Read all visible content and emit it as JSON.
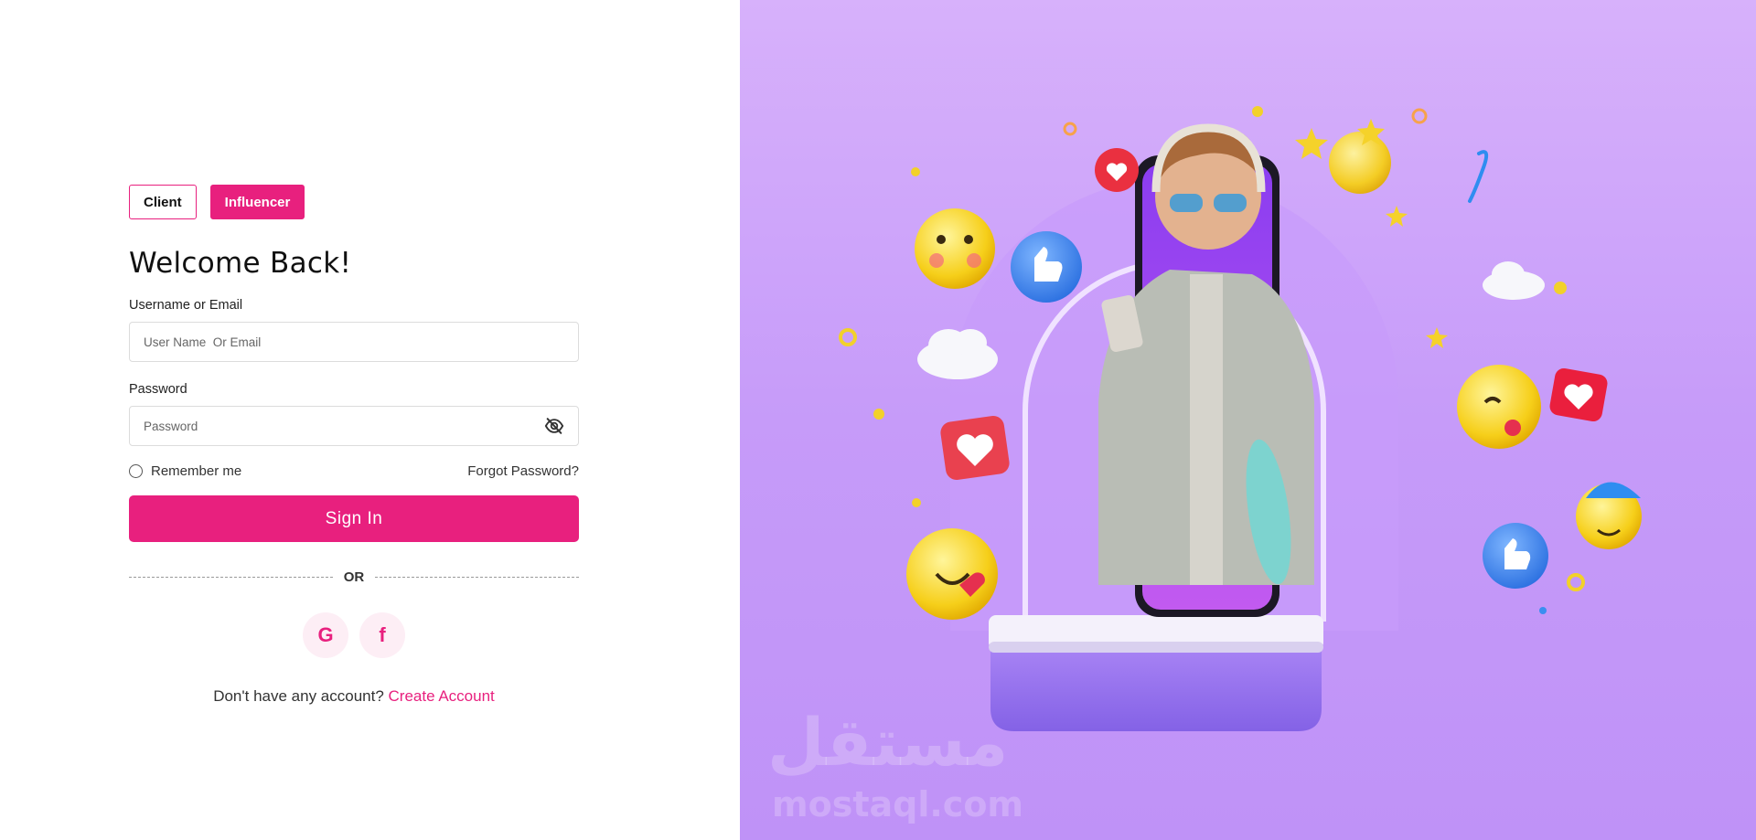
{
  "roles": {
    "client": "Client",
    "influencer": "Influencer"
  },
  "heading": "Welcome Back!",
  "username": {
    "label": "Username or Email",
    "placeholder": "User Name  Or Email"
  },
  "password": {
    "label": "Password",
    "placeholder": "Password"
  },
  "remember_label": "Remember me",
  "forgot_label": "Forgot Password?",
  "signin_label": "Sign In",
  "or_label": "OR",
  "social": {
    "google": "G",
    "facebook": "f"
  },
  "account": {
    "prompt": "Don't have any account?",
    "link": "Create Account"
  },
  "watermark": {
    "arabic": "مستقل",
    "latin": "mostaql.com"
  },
  "colors": {
    "accent": "#e8207e",
    "panel": "#c69bf9"
  },
  "icons": [
    "eye-off-icon",
    "google-icon",
    "facebook-icon"
  ]
}
